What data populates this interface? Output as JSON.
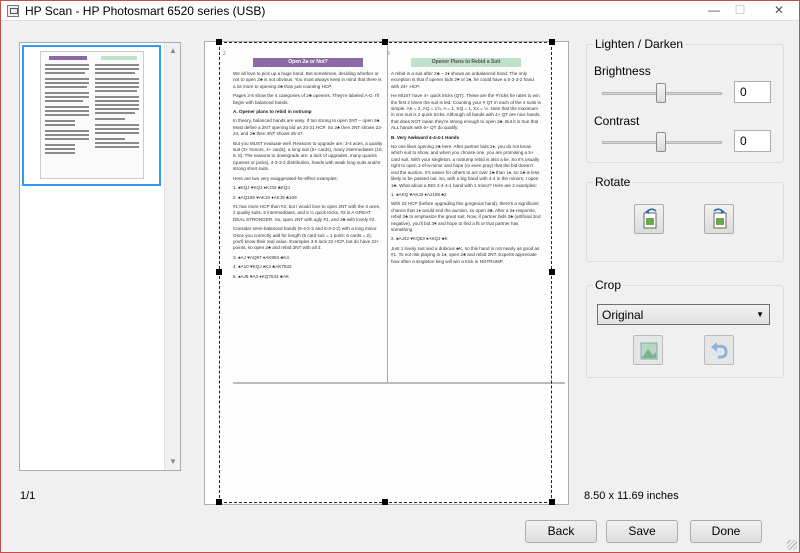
{
  "window": {
    "title": "HP Scan - HP Photosmart 6520 series (USB)",
    "minimize_glyph": "—",
    "maximize_glyph": "☐",
    "close_glyph": "✕"
  },
  "thumbnails": {
    "page_count": "1/1"
  },
  "preview": {
    "page_left": {
      "number": "2",
      "heading": "Open 2♣ or Not?",
      "intro": "We all love to pick up a huge hand. But sometimes, deciding whether or not to open 2♣ is not obvious. You must always keep in mind that there is a lot more to opening 2♣ than just counting HCP.",
      "intro2": "Pages 2-5 show the 4 categories of 2♣ openers. They're labeled A-D. I'll begin with balanced hands.",
      "section_a": "A. Opener plans to rebid in notrump",
      "body_a": "In theory, balanced hands are easy. If too strong to open 2NT – open 2♣. Most define a 2NT opening bid as 20-21 HCP. So 2♣ then 2NT shows 22-24, and 2♣ then 3NT shows 25-27.",
      "body_b": "But you MUST evaluate well. Reasons to upgrade are: 3-4 aces, a quality suit (3+ honors, 4+ cards), a long suit (5+ cards), many intermediates (10, 9, 8). The reasons to downgrade are: a lack of upgrades, many quacks (queens or jacks), 4-3-3-3 distribution, hands with weak long suits and/or strong short suits.",
      "body_c": "Here are two very exaggerated-for-effect examples:",
      "hand_1": "1. ♠KQJ ♥KQJ ♦KJ32 ♣KQJ",
      "hand_2": "2. ♠AQ109 ♥AK10 ♦AKJ9 ♣109",
      "body_d": "#1 has more HCP than #2, but I would love to open 2NT with the 3 aces, 2 quality suits, 6 intermediates, and 5 ½ quick tricks, #2 is A GREAT DEAL STRONGER. So, open 2NT with ugly #1, and 2♣ with lovely #2.",
      "body_e": "Consider semi-balanced hands (5-4-2-2 and 6-3-2-2) with a long minor. Once you correctly add for length (5 card suit = 1 point; 6 cards = 2), you'll know their real value. Examples 3-5 lack 22 HCP, but do have 22+ points, so open 2♣ and rebid 2NT with all 3.",
      "hand_3": "3. ♠AJ ♥AQ97 ♦AK984 ♣K4",
      "hand_4": "4. ♠A10 ♥KQJ ♦K3 ♣AK7532",
      "hand_5": "5. ♠AJ6 ♥A3 ♦KQ7643 ♣AK"
    },
    "page_right": {
      "number": "3",
      "heading": "Opener Plans to Rebid a Suit",
      "intro": "A rebid in a suit after 2♣ – 2♦ shows an unbalanced hand. The only exception is that if opener bids 2♥ or 2♠, he could have a 5-3-3-2 hand with 24+ HCP.",
      "body_a": "He MUST have 4+ quick tricks (QT). These are the #'ricks he rates to win the first 2 times the suit is led. Counting your # QT in each of the 4 suits is simple. AK = 2, AQ = 1½, A = 1, KQ = 1, Kx = ½. Note that the maximum in one suit is 2 quick tricks. Although all hands with 4+ QT are nice hands, that does NOT mean they're strong enough to open 2♣. But it is true that ALL hands with 6+ QT do qualify.",
      "section_b": "B. Very Awkward 4-4-4-1 Hands",
      "body_b": "No one likes opening 2♣ here. After partner bids 2♦, you do not know which suit to show, and when you choose one, you are promising a 5+ card suit. With your singleton, a notrump rebid is also a lie. So it's usually right to open 1-of-a-minor and hope (or even pray) that the bid doesn't end the auction. It's easier for others to act over 1♣ than 1♦, so 1♣ is less likely to be passed out. So, with a big hand with 4-4 in the minors, I open 1♣. What about a BIG 4-4-4-1 hand with 1 minor? Here are 2 examples:",
      "hand_1": "1. ♠AKQ ♥AKJ3 ♦AJ108 ♣2",
      "body_c": "With 23 HCP (before upgrading this gorgeous hand), there's a significant chance that 1♦ would end the auction, so open 2♣. After a 2♦ response, rebid 2♣ to emphasize the great suit. Now, if partner bids 3♣ (artificial 2nd negative), you'll bid 3♥ and hope to find a fit or that partner has something.",
      "hand_2": "2. ♠AJ42 ♥KQ53 ♦AKQJ ♣K",
      "body_d": "Just 1 lovely suit and a dubious ♣K, so this hand is not nearly as good as #1. To not risk playing in 1♦, open 2♣ and rebid 2NT. Experts appreciate how often a singleton king will win a trick in NOTRUMP."
    }
  },
  "panel": {
    "lighten_darken": {
      "title": "Lighten / Darken",
      "brightness_label": "Brightness",
      "brightness_value": "0",
      "contrast_label": "Contrast",
      "contrast_value": "0"
    },
    "rotate": {
      "title": "Rotate"
    },
    "crop": {
      "title": "Crop",
      "selected": "Original"
    },
    "dimensions": "8.50 x 11.69 inches"
  },
  "buttons": {
    "back": "Back",
    "save": "Save",
    "done": "Done"
  },
  "colors": {
    "accent_selection": "#3399ff",
    "heading_purple": "#8b6aa5",
    "heading_green": "#bfe0c9",
    "window_border": "#c0504d"
  }
}
